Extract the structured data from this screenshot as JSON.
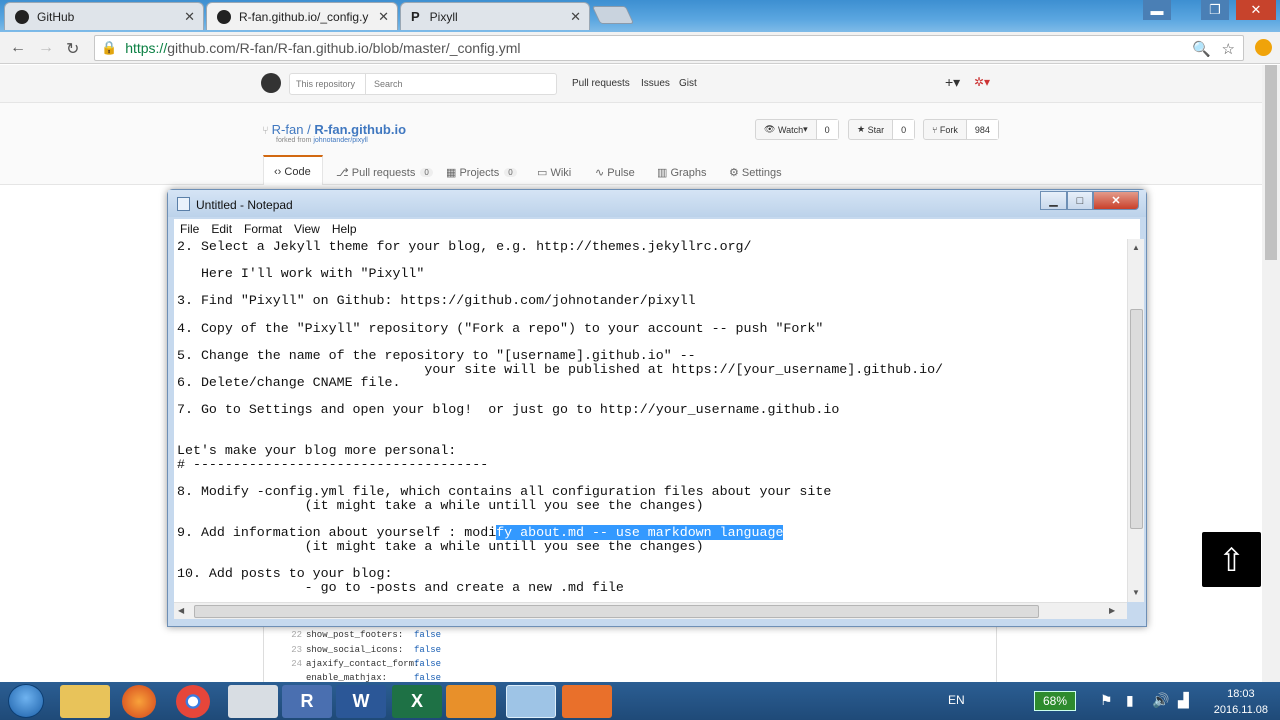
{
  "browser": {
    "tabs": [
      {
        "label": "GitHub",
        "active": false
      },
      {
        "label": "R-fan.github.io/_config.y",
        "active": true
      },
      {
        "label": "Pixyll",
        "active": false
      }
    ],
    "url_scheme": "https://",
    "url_rest": "github.com/R-fan/R-fan.github.io/blob/master/_config.yml"
  },
  "github": {
    "repo_scope": "This repository",
    "search_placeholder": "Search",
    "nav": [
      "Pull requests",
      "Issues",
      "Gist"
    ],
    "owner": "R-fan",
    "slash": "/",
    "repo": "R-fan.github.io",
    "forked_prefix": "forked from ",
    "forked_link": "johnotander/pixyll",
    "watch": {
      "label": "Watch",
      "count": "0"
    },
    "star": {
      "label": "Star",
      "count": "0"
    },
    "fork": {
      "label": "Fork",
      "count": "984"
    },
    "tabs": [
      {
        "label": "Code",
        "count": ""
      },
      {
        "label": "Pull requests",
        "count": "0"
      },
      {
        "label": "Projects",
        "count": "0"
      },
      {
        "label": "Wiki",
        "count": ""
      },
      {
        "label": "Pulse",
        "count": ""
      },
      {
        "label": "Graphs",
        "count": ""
      },
      {
        "label": "Settings",
        "count": ""
      }
    ],
    "code_lines": [
      {
        "n": "22",
        "k": "show_post_footers:",
        "v": "false"
      },
      {
        "n": "23",
        "k": "show_social_icons:",
        "v": "false"
      },
      {
        "n": "24",
        "k": "ajaxify_contact_form:",
        "v": "false"
      },
      {
        "n": "",
        "k": "enable_mathjax:",
        "v": "false"
      }
    ]
  },
  "notepad": {
    "title": "Untitled - Notepad",
    "menu": [
      "File",
      "Edit",
      "Format",
      "View",
      "Help"
    ],
    "lines": [
      "2. Select a Jekyll theme for your blog, e.g. http://themes.jekyllrc.org/",
      "   Here I'll work with \"Pixyll\"",
      "3. Find \"Pixyll\" on Github: https://github.com/johnotander/pixyll",
      "4. Copy of the \"Pixyll\" repository (\"Fork a repo\") to your account -- push \"Fork\"",
      "5. Change the name of the repository to \"[username].github.io\" --",
      "                               your site will be published at https://[your_username].github.io/",
      "6. Delete/change CNAME file.",
      "7. Go to Settings and open your blog!  or just go to http://your_username.github.io",
      "Let's make your blog more personal:",
      "# -------------------------------------",
      "8. Modify -config.yml file, which contains all configuration files about your site",
      "                (it might take a while untill you see the changes)",
      "9. Add information about yourself : modi",
      "fy about.md -- use markdown language",
      "                (it might take a while untill you see the changes)",
      "10. Add posts to your blog:",
      "                - go to -posts and create a new .md file"
    ]
  },
  "taskbar": {
    "apps": [
      "R",
      "W",
      "X"
    ],
    "language": "EN",
    "battery": "68%",
    "time": "18:03",
    "date": "2016.11.08"
  }
}
